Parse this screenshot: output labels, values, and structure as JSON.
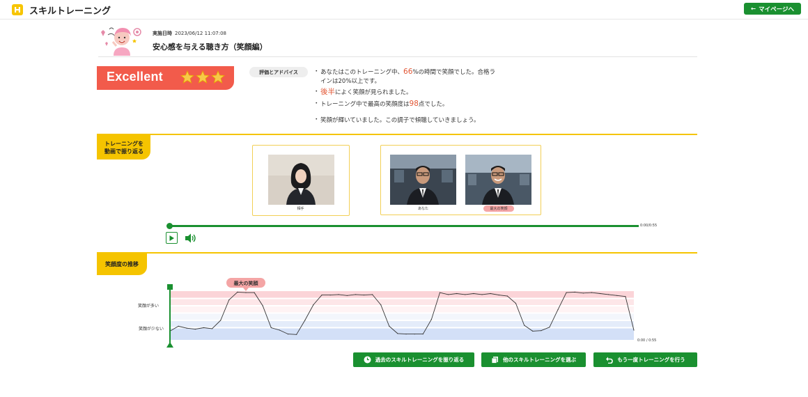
{
  "app": {
    "title": "スキルトレーニング",
    "mypage_label": "マイページへ"
  },
  "session": {
    "date_label": "実施日時",
    "date_value": "2023/06/12 11:07:08",
    "title": "安心感を与える聴き方（笑顔編）"
  },
  "score": {
    "label": "Excellent",
    "stars": 3,
    "max_stars": 3
  },
  "advice": {
    "pill": "評価とアドバイス",
    "items": [
      {
        "pre": "あなたはこのトレーニング中、",
        "em": "66",
        "post": "%の時間で笑顔でした。合格ラインは20%以上です。"
      },
      {
        "pre": "",
        "em": "後半",
        "post": "によく笑顔が見られました。"
      },
      {
        "pre": "トレーニング中で最高の笑顔度は",
        "em": "98",
        "post": "点でした。"
      },
      {
        "pre": "笑顔が輝いていました。この調子で傾聴していきましょう。",
        "em": "",
        "post": ""
      }
    ]
  },
  "video_section": {
    "tab_label_1": "トレーニングを",
    "tab_label_2": "動画で振り返る",
    "partner_caption": "相手",
    "you_caption": "あなた",
    "max_smile_tag": "最大の笑顔",
    "time": "0:00/0:55"
  },
  "chart_section": {
    "tab_label": "笑顔度の推移",
    "max_smile_tag": "最大の笑顔",
    "time": "0:00 / 0:55"
  },
  "chart_data": {
    "type": "line",
    "ylabel_high": "笑顔が多い",
    "ylabel_low": "笑顔が少ない",
    "x": [
      0,
      1,
      2,
      3,
      4,
      5,
      6,
      7,
      8,
      9,
      10,
      11,
      12,
      13,
      14,
      15,
      16,
      17,
      18,
      19,
      20,
      21,
      22,
      23,
      24,
      25,
      26,
      27,
      28,
      29,
      30,
      31,
      32,
      33,
      34,
      35,
      36,
      37,
      38,
      39,
      40,
      41,
      42,
      43,
      44,
      45,
      46,
      47,
      48,
      49,
      50,
      51,
      52,
      53,
      54,
      55
    ],
    "values": [
      18,
      28,
      24,
      22,
      25,
      23,
      40,
      82,
      98,
      97,
      97,
      70,
      25,
      20,
      12,
      11,
      40,
      72,
      92,
      92,
      93,
      91,
      93,
      92,
      93,
      72,
      28,
      13,
      12,
      12,
      12,
      42,
      97,
      93,
      95,
      93,
      95,
      93,
      95,
      92,
      90,
      75,
      30,
      18,
      19,
      26,
      62,
      97,
      98,
      96,
      97,
      95,
      93,
      91,
      89,
      20
    ],
    "xlim": [
      0,
      55
    ],
    "ylim": [
      0,
      100
    ],
    "max_index": 9
  },
  "buttons": {
    "past": "過去のスキルトレーニングを振り返る",
    "other": "他のスキルトレーニングを選ぶ",
    "retry": "もう一度トレーニングを行う"
  },
  "colors": {
    "green": "#1a9030",
    "yellow": "#f5c400",
    "excellent": "#f25b4b",
    "accent_red": "#e25634"
  }
}
